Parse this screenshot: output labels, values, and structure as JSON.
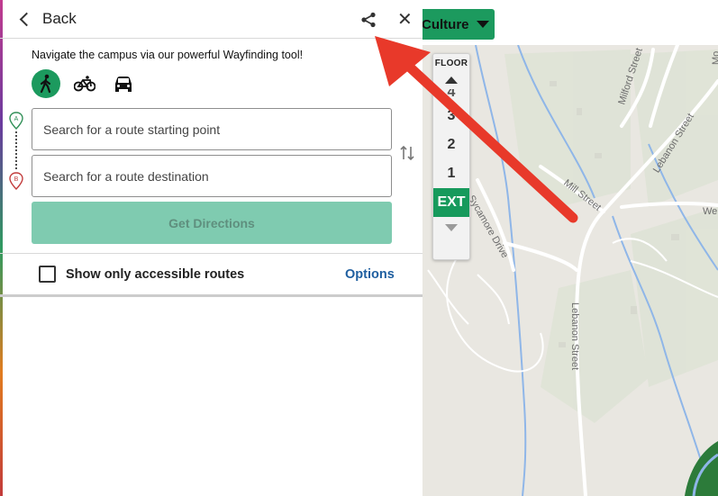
{
  "header": {
    "back_label": "Back",
    "share_icon": "share-icon",
    "close_glyph": "✕"
  },
  "intro_text": "Navigate the campus via our powerful Wayfinding tool!",
  "modes": [
    {
      "name": "walk",
      "icon": "walking-icon",
      "active": true
    },
    {
      "name": "bike",
      "icon": "bicycle-icon",
      "active": false
    },
    {
      "name": "car",
      "icon": "car-icon",
      "active": false
    }
  ],
  "markers": {
    "start": "A",
    "end": "B"
  },
  "route": {
    "start_placeholder": "Search for a route starting point",
    "dest_placeholder": "Search for a route destination",
    "get_directions_label": "Get Directions"
  },
  "accessible_label": "Show only accessible routes",
  "options_label": "Options",
  "category_button": {
    "label": "Culture"
  },
  "floor": {
    "title": "FLOOR",
    "levels": [
      "4",
      "3",
      "2",
      "1",
      "EXT"
    ],
    "active": "EXT"
  },
  "streets": {
    "milford": "Milford Street",
    "lebanon_upper": "Lebanon Street",
    "lebanon_lower": "Lebanon Street",
    "mill": "Mill Street",
    "sycamore": "Sycamore Drive",
    "we_partial": "We",
    "mo_partial": "Mo"
  },
  "colors": {
    "accent_green": "#1c9a5e",
    "button_disabled": "#7fcbb0",
    "link_blue": "#1f5fa0",
    "arrow_red": "#e8392a",
    "water": "#8fb6e8"
  }
}
